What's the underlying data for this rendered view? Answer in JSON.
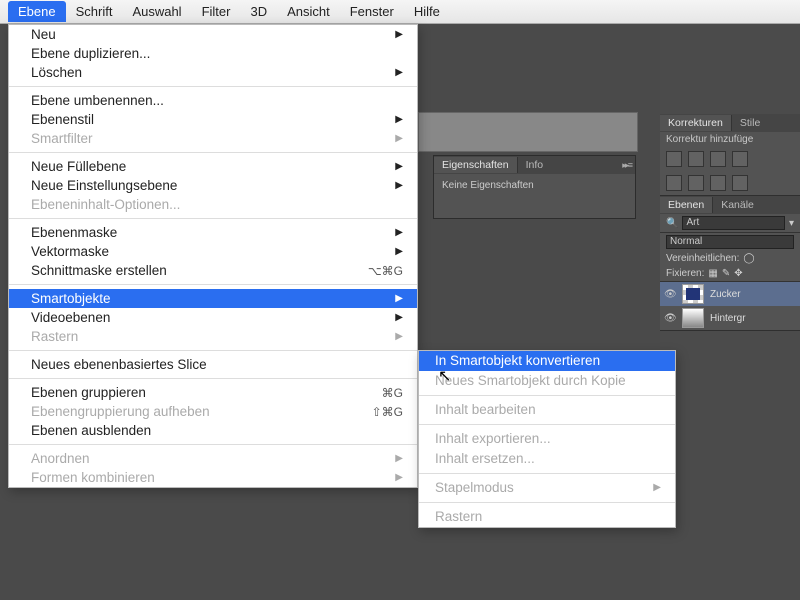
{
  "menubar": {
    "items": [
      "Ebene",
      "Schrift",
      "Auswahl",
      "Filter",
      "3D",
      "Ansicht",
      "Fenster",
      "Hilfe"
    ],
    "active_index": 0
  },
  "dropdown": [
    {
      "label": "Neu",
      "arrow": true
    },
    {
      "label": "Ebene duplizieren..."
    },
    {
      "label": "Löschen",
      "arrow": true
    },
    {
      "sep": true
    },
    {
      "label": "Ebene umbenennen..."
    },
    {
      "label": "Ebenenstil",
      "arrow": true
    },
    {
      "label": "Smartfilter",
      "arrow": true,
      "disabled": true
    },
    {
      "sep": true
    },
    {
      "label": "Neue Füllebene",
      "arrow": true
    },
    {
      "label": "Neue Einstellungsebene",
      "arrow": true
    },
    {
      "label": "Ebeneninhalt-Optionen...",
      "disabled": true
    },
    {
      "sep": true
    },
    {
      "label": "Ebenenmaske",
      "arrow": true
    },
    {
      "label": "Vektormaske",
      "arrow": true
    },
    {
      "label": "Schnittmaske erstellen",
      "shortcut": "⌥⌘G"
    },
    {
      "sep": true
    },
    {
      "label": "Smartobjekte",
      "arrow": true,
      "highlight": true
    },
    {
      "label": "Videoebenen",
      "arrow": true
    },
    {
      "label": "Rastern",
      "arrow": true,
      "disabled": true
    },
    {
      "sep": true
    },
    {
      "label": "Neues ebenenbasiertes Slice"
    },
    {
      "sep": true
    },
    {
      "label": "Ebenen gruppieren",
      "shortcut": "⌘G"
    },
    {
      "label": "Ebenengruppierung aufheben",
      "shortcut": "⇧⌘G",
      "disabled": true
    },
    {
      "label": "Ebenen ausblenden"
    },
    {
      "sep": true
    },
    {
      "label": "Anordnen",
      "arrow": true,
      "disabled": true
    },
    {
      "label": "Formen kombinieren",
      "arrow": true,
      "disabled": true
    }
  ],
  "submenu": [
    {
      "label": "In Smartobjekt konvertieren",
      "highlight": true
    },
    {
      "label": "Neues Smartobjekt durch Kopie",
      "disabled": true
    },
    {
      "sep": true
    },
    {
      "label": "Inhalt bearbeiten",
      "disabled": true
    },
    {
      "sep": true
    },
    {
      "label": "Inhalt exportieren...",
      "disabled": true
    },
    {
      "label": "Inhalt ersetzen...",
      "disabled": true
    },
    {
      "sep": true
    },
    {
      "label": "Stapelmodus",
      "arrow": true,
      "disabled": true
    },
    {
      "sep": true
    },
    {
      "label": "Rastern",
      "disabled": true
    }
  ],
  "props_panel": {
    "tabs": [
      "Eigenschaften",
      "Info"
    ],
    "body": "Keine Eigenschaften"
  },
  "right": {
    "corrections": {
      "tabs": [
        "Korrekturen",
        "Stile"
      ],
      "hint": "Korrektur hinzufüge"
    },
    "layers": {
      "tabs": [
        "Ebenen",
        "Kanäle"
      ],
      "filter_label": "Art",
      "blend": "Normal",
      "unify": "Vereinheitlichen:",
      "lock": "Fixieren:",
      "rows": [
        {
          "name": "Zucker",
          "sel": true
        },
        {
          "name": "Hintergr"
        }
      ]
    }
  }
}
